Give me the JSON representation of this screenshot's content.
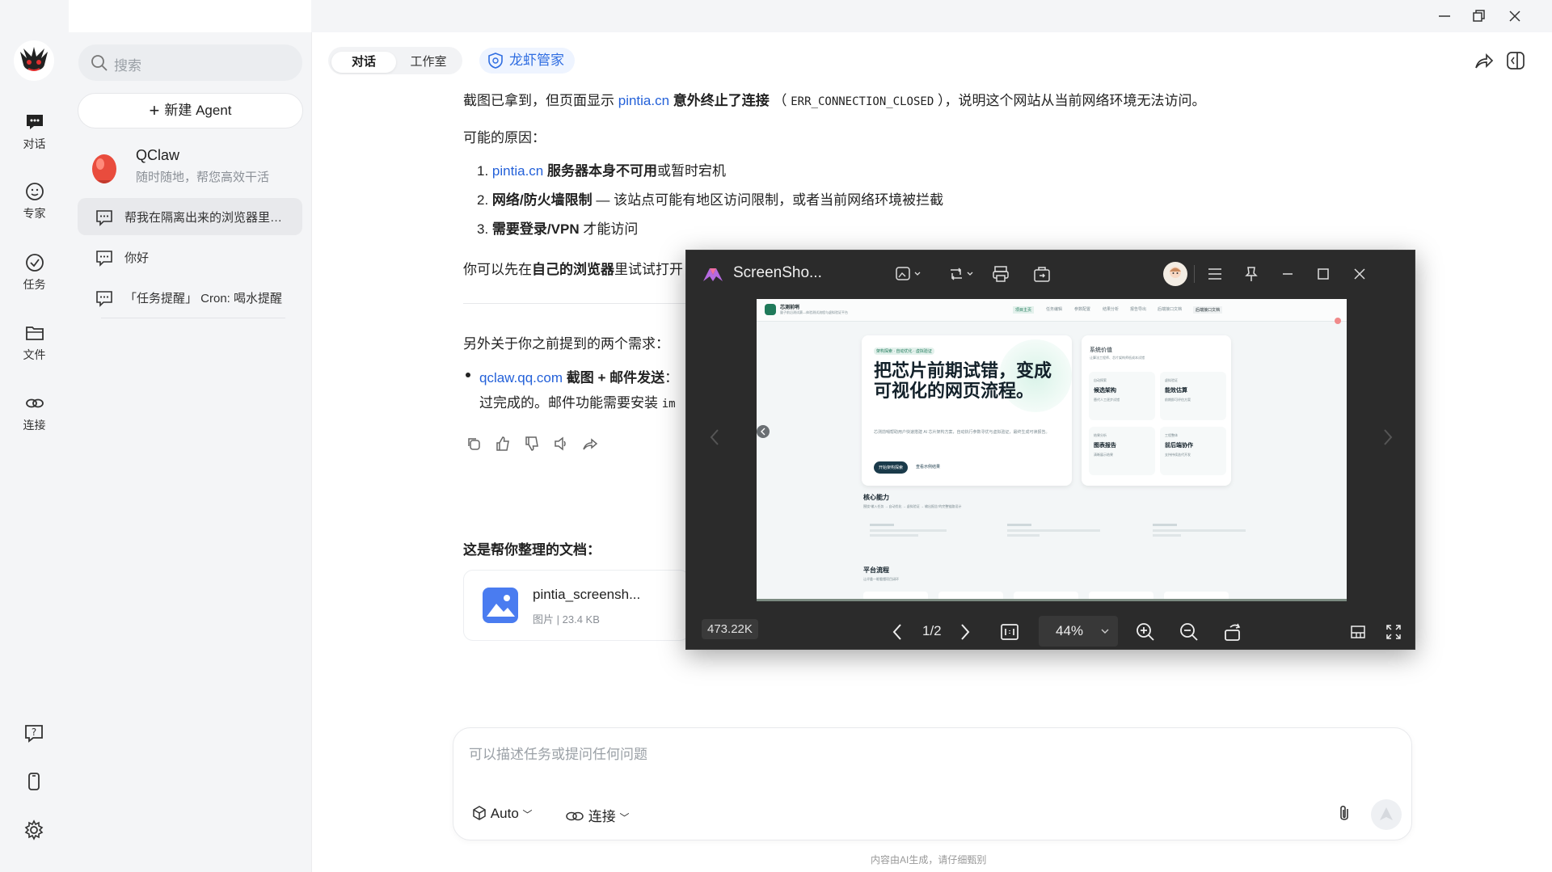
{
  "window": {
    "minimize": "—",
    "restore": "❐",
    "close": "✕"
  },
  "rail": {
    "items": [
      {
        "label": "对话"
      },
      {
        "label": "专家"
      },
      {
        "label": "任务"
      },
      {
        "label": "文件"
      },
      {
        "label": "连接"
      }
    ]
  },
  "sidebar": {
    "search_placeholder": "搜索",
    "new_agent": "新建 Agent",
    "agent": {
      "name": "QClaw",
      "subtitle": "随时随地，帮您高效干活"
    },
    "conversations": [
      {
        "title": "帮我在隔离出来的浏览器里…",
        "active": true
      },
      {
        "title": "你好"
      },
      {
        "title": "「任务提醒」 Cron: 喝水提醒"
      }
    ]
  },
  "header": {
    "tabs": [
      {
        "label": "对话",
        "active": true
      },
      {
        "label": "工作室"
      }
    ],
    "lobster": "龙虾管家"
  },
  "message": {
    "line1_a": "截图已拿到，但页面显示 ",
    "line1_link": "pintia.cn",
    "line1_b": " 意外终止了连接",
    "line1_c": " （ ",
    "line1_code": "ERR_CONNECTION_CLOSED",
    "line1_d": " ），说明这个网站从当前网络环境无法访问。",
    "reasons_title": "可能的原因：",
    "r1_num": "1.",
    "r1_link": "pintia.cn",
    "r1_bold": " 服务器本身不可用",
    "r1_rest": "或暂时宕机",
    "r2_num": "2.",
    "r2_bold": "网络/防火墙限制",
    "r2_rest": " — 该站点可能有地区访问限制，或者当前网络环境被拦截",
    "r3_num": "3.",
    "r3_bold": "需要登录/VPN",
    "r3_rest": " 才能访问",
    "try_a": "你可以先在",
    "try_bold": "自己的浏览器",
    "try_b": "里试试打开",
    "other": "另外关于你之前提到的两个需求：",
    "bullet_link": "qclaw.qq.com",
    "bullet_bold": " 截图 + 邮件发送",
    "bullet_rest": "：",
    "bullet_line2": "过完成的。邮件功能需要安装 ",
    "bullet_code": "im",
    "doc_title": "这是帮你整理的文档：",
    "file": {
      "name": "pintia_screensh...",
      "type": "图片",
      "size": "23.4 KB"
    }
  },
  "input": {
    "placeholder": "可以描述任务或提问任何问题",
    "mode": "Auto",
    "connect": "连接"
  },
  "footer": "内容由AI生成，请仔细甄别",
  "viewer": {
    "title": "ScreenSho...",
    "filesize": "473.22K",
    "page": "1/2",
    "zoom": "44%",
    "page_content": {
      "logo": "芯测前哨",
      "tagline": "量子前沿测试赛—体验测试流程与虚拟验证平台",
      "nav": [
        "项目主页",
        "任务编辑",
        "参数配置",
        "结果分析",
        "报告导出",
        "后端接口文档"
      ],
      "badge": "架构探索 · 自动优化 · 虚拟验证",
      "hero": "把芯片前期试错，变成可视化的网页流程。",
      "hero_desc": "芯测前哨帮助用户快速搭建 AI 芯片架构方案，自动执行参数寻优与虚拟验证，最终生成可读报告。",
      "btn_primary": "开始架构探索",
      "btn_secondary": "查看示例结果",
      "value_title": "系统价值",
      "value_sub": "让算法工程师、芯片架构师低成本试错",
      "cards": [
        {
          "tag": "自动探索",
          "title": "候选架构",
          "desc": "替代人工逐步试错"
        },
        {
          "tag": "虚拟验证",
          "title": "能效估算",
          "desc": "前期即可评估方案"
        },
        {
          "tag": "结果分析",
          "title": "图表报告",
          "desc": "清晰展示结果"
        },
        {
          "tag": "工程整体",
          "title": "前后端协作",
          "desc": "支持持续迭代开发"
        }
      ],
      "core_title": "核心能力",
      "core_desc": "围绕“输入任务 → 自动优化 → 虚拟验证 → 输出报告”的完整链路设计",
      "flow_title": "平台流程",
      "flow_desc": "让评委一眼看懂项目闭环"
    }
  },
  "colors": {
    "accent": "#2461d9",
    "rail_bg": "#f4f5f7",
    "viewer_bg": "#2b2b2b",
    "brand_green": "#1f7a5a"
  }
}
